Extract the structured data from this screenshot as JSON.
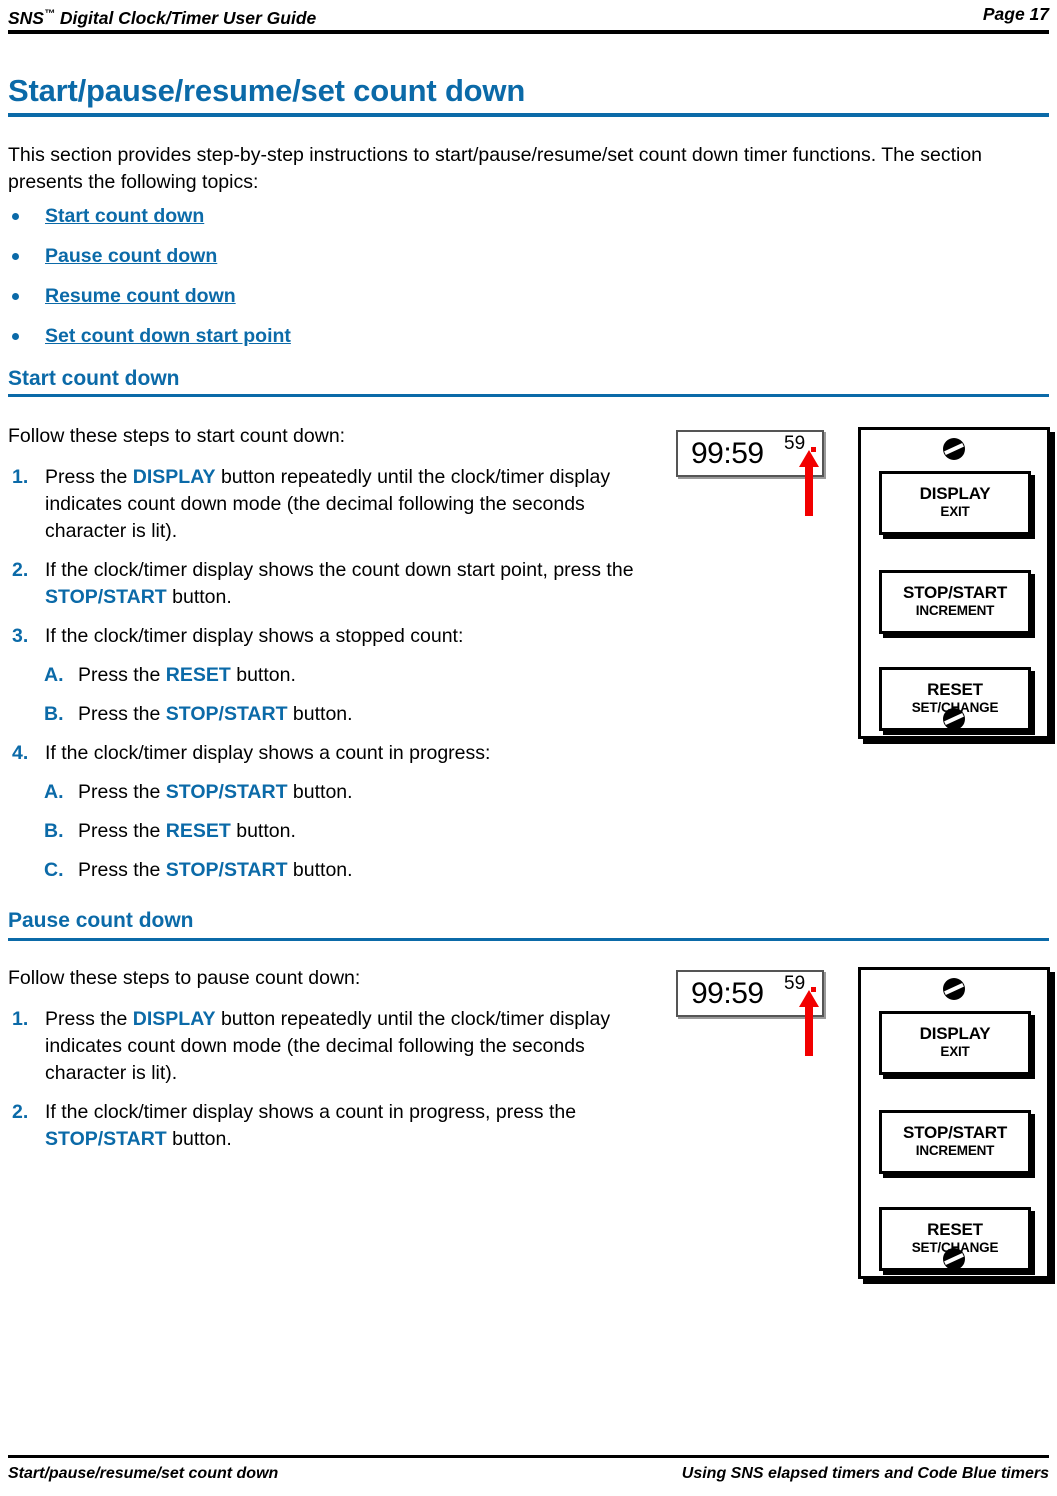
{
  "header": {
    "doc_title_prefix": "SNS",
    "doc_title_tm": "™",
    "doc_title_rest": " Digital Clock/Timer User Guide",
    "page_label": "Page 17"
  },
  "chapter": {
    "title": "Start/pause/resume/set count down",
    "intro": "This section provides step-by-step instructions to start/pause/resume/set count down timer functions. The section presents the following topics:",
    "topics": [
      {
        "label": "Start count down"
      },
      {
        "label": "Pause count down"
      },
      {
        "label": "Resume count down"
      },
      {
        "label": "Set count down start point"
      }
    ]
  },
  "sections": [
    {
      "heading": "Start count down",
      "lead": "Follow these steps to start count down:",
      "steps": [
        {
          "num": "1.",
          "parts": [
            {
              "t": "Press the ",
              "kw": false
            },
            {
              "t": "DISPLAY",
              "kw": true
            },
            {
              "t": " button repeatedly until the clock/timer display indicates count down mode (the decimal following the seconds character is lit).",
              "kw": false
            }
          ],
          "subs": []
        },
        {
          "num": "2.",
          "parts": [
            {
              "t": "If the clock/timer display shows the count down start point, press the ",
              "kw": false
            },
            {
              "t": "STOP/START",
              "kw": true
            },
            {
              "t": " button.",
              "kw": false
            }
          ],
          "subs": []
        },
        {
          "num": "3.",
          "parts": [
            {
              "t": "If the clock/timer display shows a stopped count:",
              "kw": false
            }
          ],
          "subs": [
            {
              "letter": "A.",
              "parts": [
                {
                  "t": "Press the ",
                  "kw": false
                },
                {
                  "t": "RESET",
                  "kw": true
                },
                {
                  "t": " button.",
                  "kw": false
                }
              ]
            },
            {
              "letter": "B.",
              "parts": [
                {
                  "t": "Press the ",
                  "kw": false
                },
                {
                  "t": "STOP/START",
                  "kw": true
                },
                {
                  "t": " button.",
                  "kw": false
                }
              ]
            }
          ]
        },
        {
          "num": "4.",
          "parts": [
            {
              "t": "If the clock/timer display shows a count in progress:",
              "kw": false
            }
          ],
          "subs": [
            {
              "letter": "A.",
              "parts": [
                {
                  "t": "Press the ",
                  "kw": false
                },
                {
                  "t": "STOP/START",
                  "kw": true
                },
                {
                  "t": " button.",
                  "kw": false
                }
              ]
            },
            {
              "letter": "B.",
              "parts": [
                {
                  "t": "Press the ",
                  "kw": false
                },
                {
                  "t": "RESET",
                  "kw": true
                },
                {
                  "t": " button.",
                  "kw": false
                }
              ]
            },
            {
              "letter": "C.",
              "parts": [
                {
                  "t": "Press the ",
                  "kw": false
                },
                {
                  "t": "STOP/START",
                  "kw": true
                },
                {
                  "t": " button.",
                  "kw": false
                }
              ]
            }
          ]
        }
      ]
    },
    {
      "heading": "Pause count down",
      "lead": "Follow these steps to pause count down:",
      "steps": [
        {
          "num": "1.",
          "parts": [
            {
              "t": "Press the ",
              "kw": false
            },
            {
              "t": "DISPLAY",
              "kw": true
            },
            {
              "t": " button repeatedly until the clock/timer display indicates count down mode (the decimal following the seconds character is lit).",
              "kw": false
            }
          ],
          "subs": []
        },
        {
          "num": "2.",
          "parts": [
            {
              "t": "If the clock/timer display shows a count in progress, press the ",
              "kw": false
            },
            {
              "t": "STOP/START",
              "kw": true
            },
            {
              "t": " button.",
              "kw": false
            }
          ],
          "subs": []
        }
      ]
    }
  ],
  "lcd": {
    "time": "99:59",
    "superscript": "59",
    "decimal_color": "#f20000",
    "arrow_color": "#f20000"
  },
  "device": {
    "buttons": [
      {
        "primary": "DISPLAY",
        "secondary": "EXIT"
      },
      {
        "primary": "STOP/START",
        "secondary": "INCREMENT"
      },
      {
        "primary": "RESET",
        "secondary": "SET/CHANGE"
      }
    ],
    "screw_top": "screw",
    "screw_bottom": "screw"
  },
  "footer": {
    "left": "Start/pause/resume/set count down",
    "right": "Using SNS elapsed timers and Code Blue timers"
  },
  "colors": {
    "accent_blue": "#0b6aa8",
    "rule_black": "#000000",
    "red": "#f20000"
  }
}
